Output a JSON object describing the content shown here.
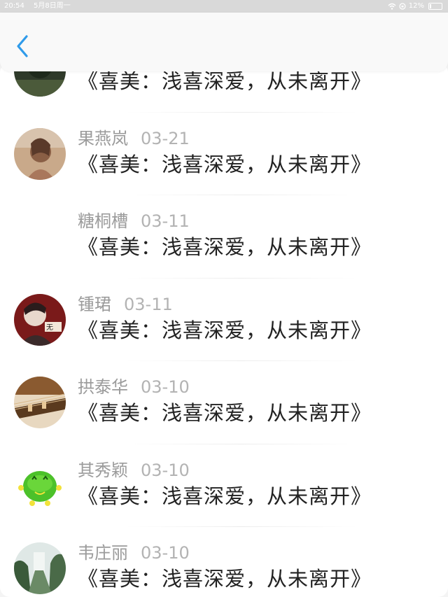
{
  "status_bar": {
    "time": "20:54",
    "date": "5月8日周一",
    "battery_text": "12%",
    "battery_level": 0.12
  },
  "nav": {
    "back_icon": "chevron-left-icon",
    "accent_color": "#2f9bea"
  },
  "comments": [
    {
      "name": "",
      "date": "",
      "text": "《喜美：浅喜深爱，从未离开》",
      "avatar": "dark-green"
    },
    {
      "name": "果燕岚",
      "date": "03-21",
      "text": "《喜美：浅喜深爱，从未离开》",
      "avatar": "portrait-warm"
    },
    {
      "name": "糖桐槽",
      "date": "03-11",
      "text": "《喜美：浅喜深爱，从未离开》",
      "avatar": "none"
    },
    {
      "name": "锺珺",
      "date": "03-11",
      "text": "《喜美：浅喜深爱，从未离开》",
      "avatar": "portrait-red"
    },
    {
      "name": "拱泰华",
      "date": "03-10",
      "text": "《喜美：浅喜深爱，从未离开》",
      "avatar": "guzheng-brown"
    },
    {
      "name": "其秀颖",
      "date": "03-10",
      "text": "《喜美：浅喜深爱，从未离开》",
      "avatar": "green-cartoon"
    },
    {
      "name": "韦庄丽",
      "date": "03-10",
      "text": "《喜美：浅喜深爱，从未离开》",
      "avatar": "waterfall-green"
    }
  ]
}
